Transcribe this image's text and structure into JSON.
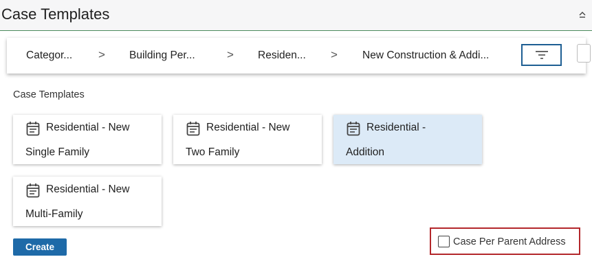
{
  "header": {
    "title": "Case Templates",
    "collapse_icon": "chevron-up-icon"
  },
  "breadcrumb": {
    "items": [
      {
        "label": "Categor..."
      },
      {
        "label": "Building Per..."
      },
      {
        "label": "Residen..."
      },
      {
        "label": "New Construction & Addi..."
      }
    ],
    "separator": ">",
    "filter_icon": "filter-icon"
  },
  "section": {
    "label": "Case Templates"
  },
  "templates": [
    {
      "line1": "Residential - New",
      "line2": "Single Family",
      "icon": "calendar-icon",
      "selected": false
    },
    {
      "line1": "Residential - New",
      "line2": "Two Family",
      "icon": "calendar-icon",
      "selected": false
    },
    {
      "line1": "Residential -",
      "line2": "Addition",
      "icon": "calendar-icon",
      "selected": true
    },
    {
      "line1": "Residential - New",
      "line2": "Multi-Family",
      "icon": "calendar-icon",
      "selected": false
    }
  ],
  "actions": {
    "create_label": "Create"
  },
  "options": {
    "case_per_parent_address_label": "Case Per Parent Address",
    "case_per_parent_address_checked": false
  },
  "colors": {
    "accent": "#1e6aa8",
    "selected_card": "#dceaf7",
    "highlight_border": "#b3262a",
    "header_rule": "#4a8a5c"
  }
}
